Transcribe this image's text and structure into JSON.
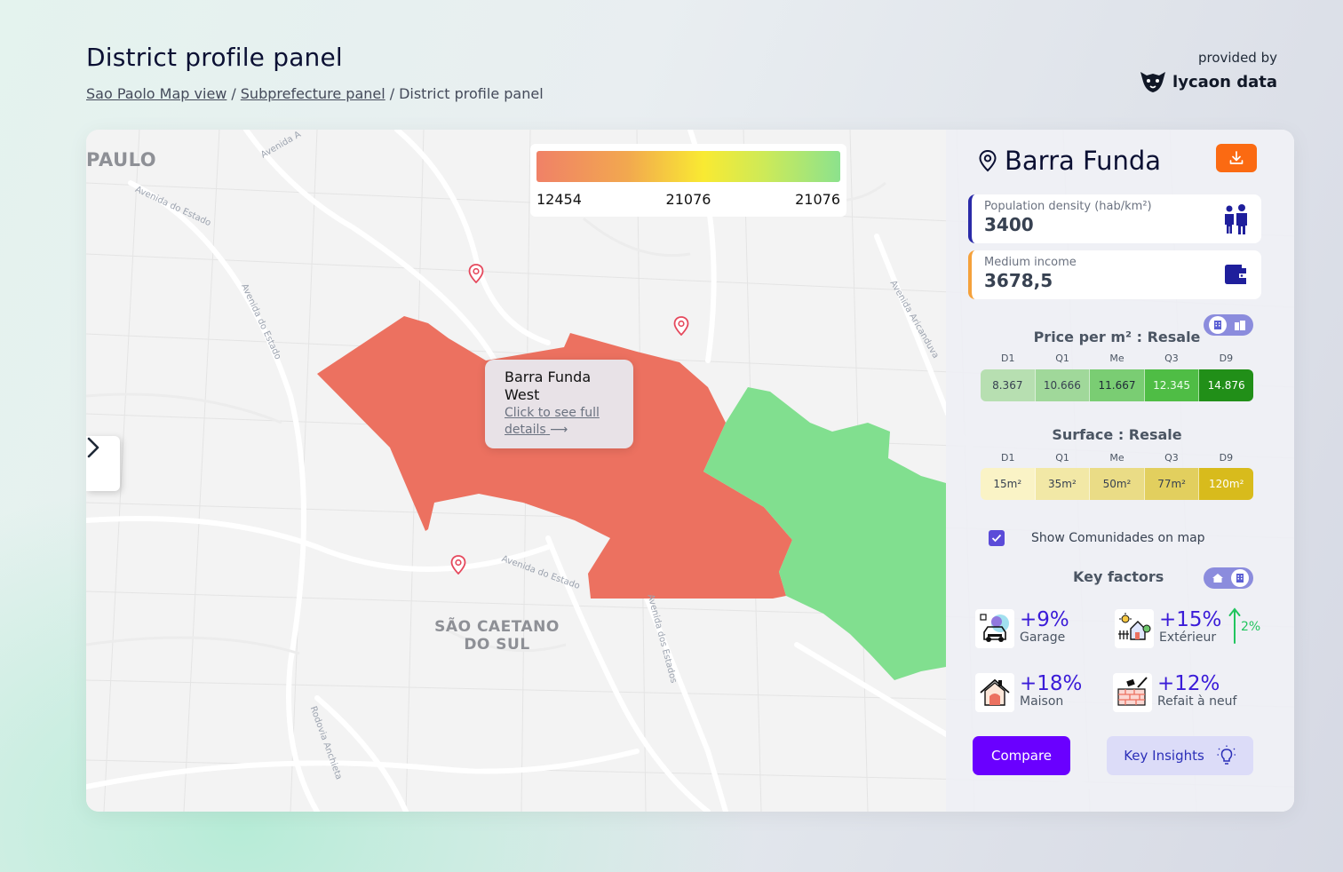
{
  "header": {
    "title": "District profile panel",
    "breadcrumb": [
      {
        "label": "Sao Paolo Map view",
        "link": true
      },
      {
        "label": "Subprefecture panel",
        "link": true
      },
      {
        "label": "District profile panel",
        "link": false
      }
    ],
    "brand": {
      "provided_by": "provided by",
      "name": "lycaon data"
    }
  },
  "map": {
    "city_label": "PAULO",
    "area_label": "SÃO CAETANO DO SUL",
    "streets": [
      "Avenida A",
      "Avenida do Estado",
      "Avenida do Estado",
      "Avenida Aricanduva",
      "Rodovia Anchieta",
      "Avenida dos Estados",
      "Avenida do Estado"
    ],
    "legend": {
      "min": "12454",
      "mid": "21076",
      "max": "21076"
    },
    "tooltip": {
      "title": "Barra Funda West",
      "link": "Click to see full details",
      "arrow": "⟶"
    },
    "colors": {
      "high": "#ec7160",
      "low": "#81df8f"
    }
  },
  "panel": {
    "district": "Barra Funda",
    "population": {
      "label": "Population density (hab/km²)",
      "value": "3400"
    },
    "income": {
      "label": "Medium income",
      "value": "3678,5"
    },
    "price": {
      "title": "Price per m² : Resale",
      "headers": [
        "D1",
        "Q1",
        "Me",
        "Q3",
        "D9"
      ],
      "values": [
        "8.367",
        "10.666",
        "11.667",
        "12.345",
        "14.876"
      ],
      "colors": [
        "#b7dfb1",
        "#a0d89a",
        "#7acd73",
        "#4fbd45",
        "#218f18"
      ]
    },
    "surface": {
      "title": "Surface : Resale",
      "headers": [
        "D1",
        "Q1",
        "Me",
        "Q3",
        "D9"
      ],
      "values": [
        "15m²",
        "35m²",
        "50m²",
        "77m²",
        "120m²"
      ],
      "colors": [
        "#faf3c6",
        "#f2e8a6",
        "#eadc86",
        "#e2cf5e",
        "#d8bb1c"
      ]
    },
    "communities": {
      "label": "Show Comunidades on map",
      "checked": true
    },
    "key_factors": {
      "title": "Key factors",
      "items": [
        {
          "value": "+9%",
          "label": "Garage",
          "icon": "garage-icon"
        },
        {
          "value": "+15%",
          "label": "Extérieur",
          "icon": "exterior-icon"
        },
        {
          "value": "+18%",
          "label": "Maison",
          "icon": "house-icon"
        },
        {
          "value": "+12%",
          "label": "Refait à neuf",
          "icon": "renovation-icon"
        }
      ],
      "trend": "2%"
    },
    "buttons": {
      "compare": "Compare",
      "insights": "Key Insights"
    }
  }
}
